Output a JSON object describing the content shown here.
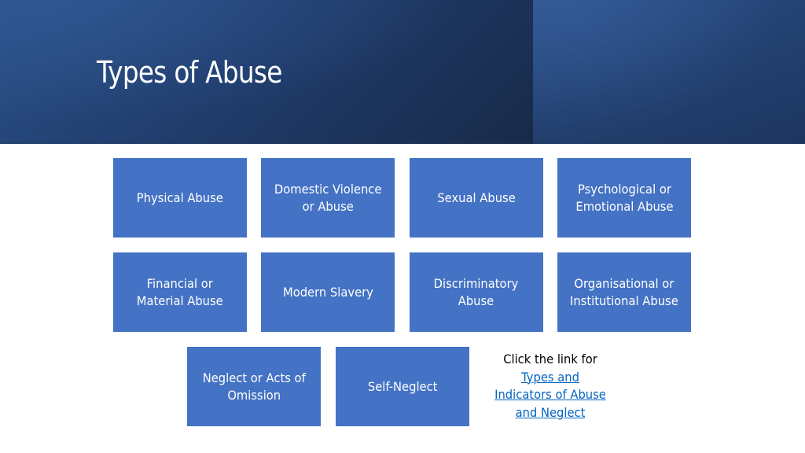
{
  "slide": {
    "title": "Types of Abuse",
    "colors": {
      "header_dark": "#1a2e50",
      "header_light": "#2b4f88",
      "box_fill": "#4472c4",
      "box_text": "#ffffff",
      "link": "#0563c1"
    }
  },
  "boxes": [
    {
      "label": "Physical Abuse"
    },
    {
      "label": "Domestic Violence\nor Abuse"
    },
    {
      "label": "Sexual Abuse"
    },
    {
      "label": "Psychological or\nEmotional Abuse"
    },
    {
      "label": "Financial or\nMaterial Abuse"
    },
    {
      "label": "Modern Slavery"
    },
    {
      "label": "Discriminatory\nAbuse"
    },
    {
      "label": "Organisational or\nInstitutional Abuse"
    },
    {
      "label": "Neglect or Acts of\nOmission"
    },
    {
      "label": "Self-Neglect"
    }
  ],
  "link_note": {
    "lead_text": "Click the link for",
    "link_text": "Types and\nIndicators of Abuse\nand Neglect"
  }
}
